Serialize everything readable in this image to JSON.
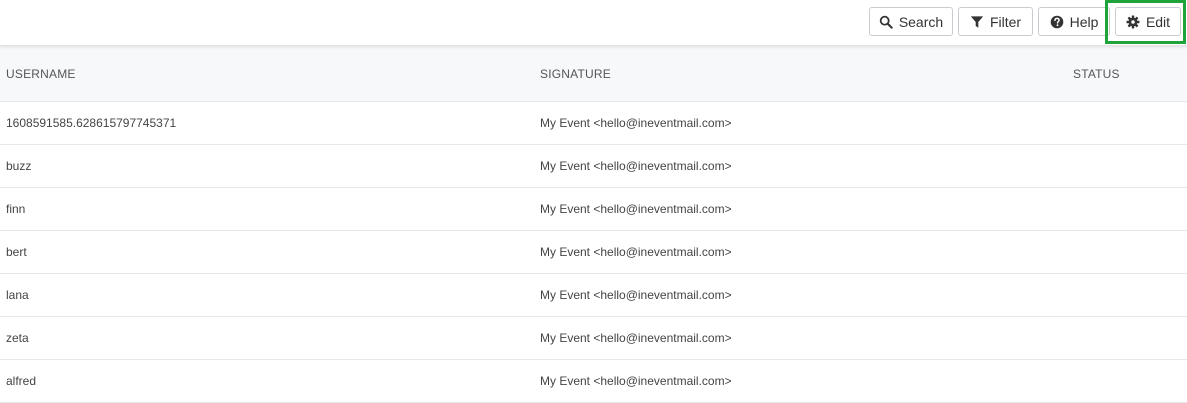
{
  "toolbar": {
    "search_label": "Search",
    "filter_label": "Filter",
    "help_label": "Help",
    "edit_label": "Edit",
    "highlight_color": "#1fa33b"
  },
  "table": {
    "columns": [
      "USERNAME",
      "SIGNATURE",
      "STATUS"
    ],
    "rows": [
      {
        "username": "1608591585.628615797745371",
        "signature": "My Event <hello@ineventmail.com>",
        "status": ""
      },
      {
        "username": "buzz",
        "signature": "My Event <hello@ineventmail.com>",
        "status": ""
      },
      {
        "username": "finn",
        "signature": "My Event <hello@ineventmail.com>",
        "status": ""
      },
      {
        "username": "bert",
        "signature": "My Event <hello@ineventmail.com>",
        "status": ""
      },
      {
        "username": "lana",
        "signature": "My Event <hello@ineventmail.com>",
        "status": ""
      },
      {
        "username": "zeta",
        "signature": "My Event <hello@ineventmail.com>",
        "status": ""
      },
      {
        "username": "alfred",
        "signature": "My Event <hello@ineventmail.com>",
        "status": ""
      }
    ]
  }
}
